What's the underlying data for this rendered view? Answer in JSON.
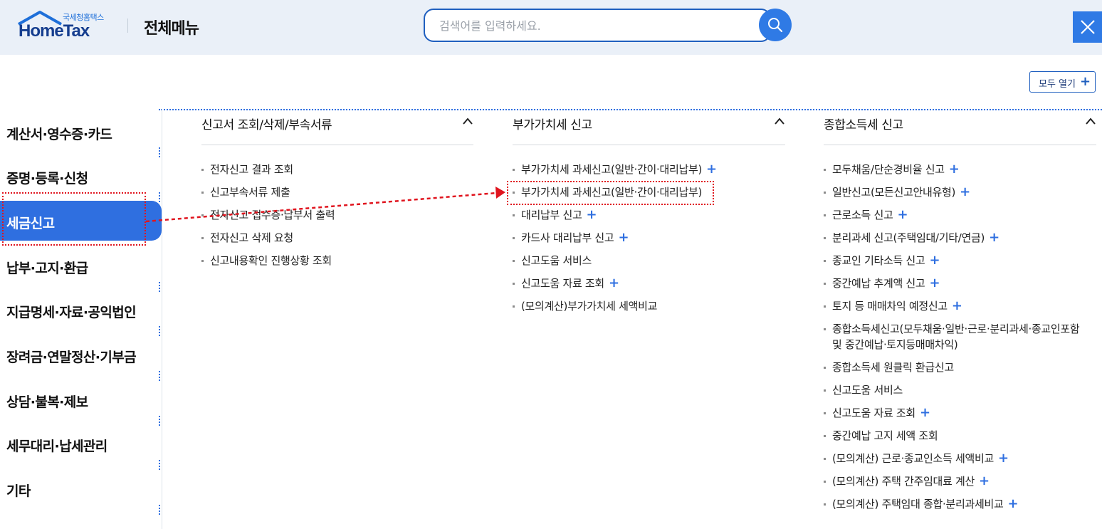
{
  "header": {
    "logo_kr": "국세청홈택스",
    "logo_en": "HomeTax",
    "page_title": "전체메뉴",
    "search_placeholder": "검색어를 입력하세요."
  },
  "expand_all_label": "모두 열기",
  "expand_all_plus": "+",
  "leftnav": [
    {
      "label": "계산서·영수증·카드"
    },
    {
      "label": "증명·등록·신청"
    },
    {
      "label": "세금신고"
    },
    {
      "label": "납부·고지·환급"
    },
    {
      "label": "지급명세·자료·공익법인"
    },
    {
      "label": "장려금·연말정산·기부금"
    },
    {
      "label": "상담·불복·제보"
    },
    {
      "label": "세무대리·납세관리"
    },
    {
      "label": "기타"
    }
  ],
  "columns": [
    {
      "title": "신고서 조회/삭제/부속서류",
      "items": [
        {
          "text": "전자신고 결과 조회",
          "plus": ""
        },
        {
          "text": "신고부속서류 제출",
          "plus": ""
        },
        {
          "text": "전자신고 접수증·납부서 출력",
          "plus": ""
        },
        {
          "text": "전자신고 삭제 요청",
          "plus": ""
        },
        {
          "text": "신고내용확인 진행상황 조회",
          "plus": ""
        }
      ]
    },
    {
      "title": "부가가치세 신고",
      "items": [
        {
          "text": "부가가치세 과세신고(일반·간이·대리납부)",
          "plus": "+"
        },
        {
          "text": "부가가치세 과세신고(일반·간이·대리납부)",
          "plus": ""
        },
        {
          "text": "대리납부 신고",
          "plus": "+"
        },
        {
          "text": "카드사 대리납부 신고",
          "plus": "+"
        },
        {
          "text": "신고도움 서비스",
          "plus": ""
        },
        {
          "text": "신고도움 자료 조회",
          "plus": "+"
        },
        {
          "text": "(모의계산)부가가치세 세액비교",
          "plus": ""
        }
      ]
    },
    {
      "title": "종합소득세 신고",
      "items": [
        {
          "text": "모두채움/단순경비율 신고",
          "plus": "+"
        },
        {
          "text": "일반신고(모든신고안내유형)",
          "plus": "+"
        },
        {
          "text": "근로소득 신고",
          "plus": "+"
        },
        {
          "text": "분리과세 신고(주택임대/기타/연금)",
          "plus": "+"
        },
        {
          "text": "종교인 기타소득 신고",
          "plus": "+"
        },
        {
          "text": "중간예납 추계액 신고",
          "plus": "+"
        },
        {
          "text": "토지 등 매매차익 예정신고",
          "plus": "+"
        },
        {
          "text": "종합소득세신고(모두채움·일반·근로·분리과세·종교인포함",
          "text2": "및 중간예납·토지등매매차익)",
          "plus": ""
        },
        {
          "text": "종합소득세 원클릭 환급신고",
          "plus": ""
        },
        {
          "text": "신고도움 서비스",
          "plus": ""
        },
        {
          "text": "신고도움 자료 조회",
          "plus": "+"
        },
        {
          "text": "중간예납 고지 세액 조회",
          "plus": ""
        },
        {
          "text": "(모의계산) 근로·종교인소득 세액비교",
          "plus": "+"
        },
        {
          "text": "(모의계산) 주택 간주임대료 계산",
          "plus": "+"
        },
        {
          "text": "(모의계산) 주택임대 종합·분리과세비교",
          "plus": "+"
        }
      ]
    }
  ],
  "colors": {
    "accent": "#2f6fe0",
    "header_bg": "#eaf0f8",
    "annotation": "#e0141e"
  }
}
